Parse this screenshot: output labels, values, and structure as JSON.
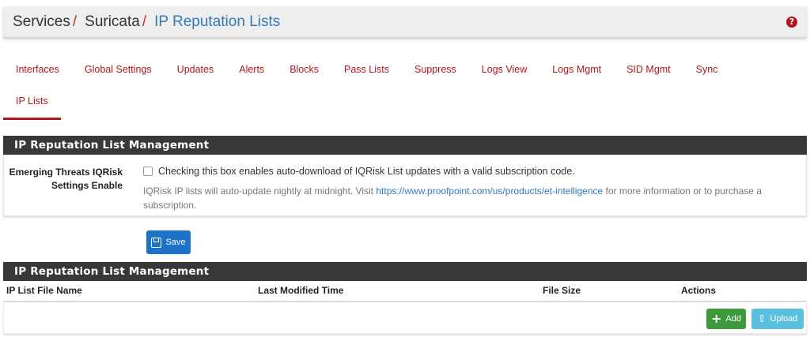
{
  "breadcrumb": {
    "items": [
      "Services",
      "Suricata",
      "IP Reputation Lists"
    ],
    "separator": "/"
  },
  "help_icon": "?",
  "tabs": {
    "row1": [
      "Interfaces",
      "Global Settings",
      "Updates",
      "Alerts",
      "Blocks",
      "Pass Lists",
      "Suppress",
      "Logs View",
      "Logs Mgmt",
      "SID Mgmt",
      "Sync"
    ],
    "row2": [
      "IP Lists"
    ],
    "active": "IP Lists"
  },
  "settings_panel": {
    "title": "IP Reputation List Management",
    "label_line1": "Emerging Threats IQRisk",
    "label_line2": "Settings Enable",
    "checkbox_label": "Checking this box enables auto-download of IQRisk List updates with a valid subscription code.",
    "checkbox_checked": false,
    "help_prefix": "IQRisk IP lists will auto-update nightly at midnight. Visit ",
    "help_link": "https://www.proofpoint.com/us/products/et-intelligence",
    "help_suffix": " for more information or to purchase a subscription."
  },
  "save_button": "Save",
  "lists_panel": {
    "title": "IP Reputation List Management",
    "columns": [
      "IP List File Name",
      "Last Modified Time",
      "File Size",
      "Actions"
    ],
    "rows": [],
    "add_button": "Add",
    "upload_button": "Upload"
  },
  "colors": {
    "accent": "#b0161b",
    "link": "#337ab7",
    "panel_heading": "#383838",
    "save": "#1e73c7",
    "add": "#3c9a3c",
    "upload": "#5bc0de"
  }
}
